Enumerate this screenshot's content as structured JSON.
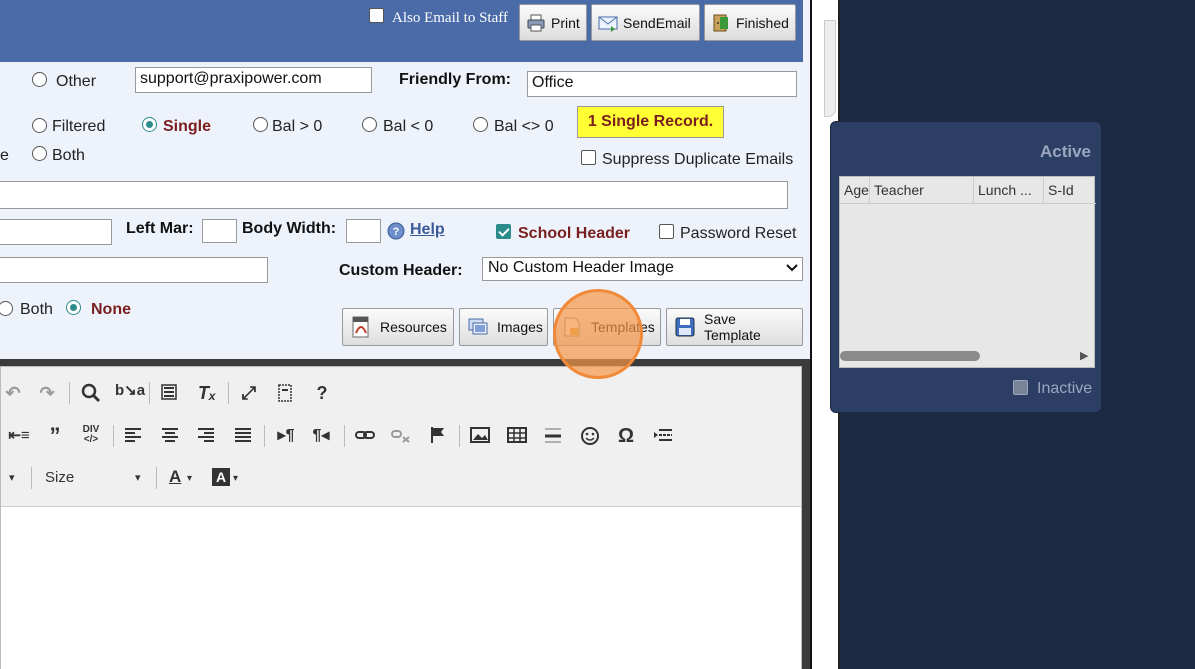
{
  "toolbar": {
    "also_email_staff": "Also Email to Staff",
    "print": "Print",
    "sendemail": "SendEmail",
    "finished": "Finished"
  },
  "form": {
    "other_label": "Other",
    "from_email": "support@praxipower.com",
    "friendly_from_label": "Friendly From:",
    "friendly_from_value": "Office",
    "filtered_label": "Filtered",
    "single_label": "Single",
    "bal_gt_label": "Bal > 0",
    "bal_lt_label": "Bal < 0",
    "bal_ne_label": "Bal <> 0",
    "record_badge": "1 Single Record.",
    "partial_e": "e",
    "both_label": "Both",
    "suppress_label": "Suppress Duplicate Emails",
    "left_mar_label": "Left Mar:",
    "body_width_label": "Body Width:",
    "help_label": "Help",
    "school_header_label": "School Header",
    "password_reset_label": "Password Reset",
    "custom_header_label": "Custom Header:",
    "custom_header_value": "No Custom Header Image",
    "both2_label": "Both",
    "none_label": "None"
  },
  "actions": {
    "resources": "Resources",
    "images": "Images",
    "templates": "Templates",
    "save_template": "Save Template"
  },
  "editor": {
    "size_label": "Size"
  },
  "popup": {
    "active_label": "Active",
    "columns": [
      "Age",
      "Teacher",
      "Lunch ...",
      "S-Id"
    ],
    "inactive_label": "Inactive"
  },
  "colors": {
    "header_blue": "#4a6ba8",
    "accent_teal": "#2c8c8c",
    "label_red": "#7a1f1f",
    "highlight": "#f08a3a"
  }
}
